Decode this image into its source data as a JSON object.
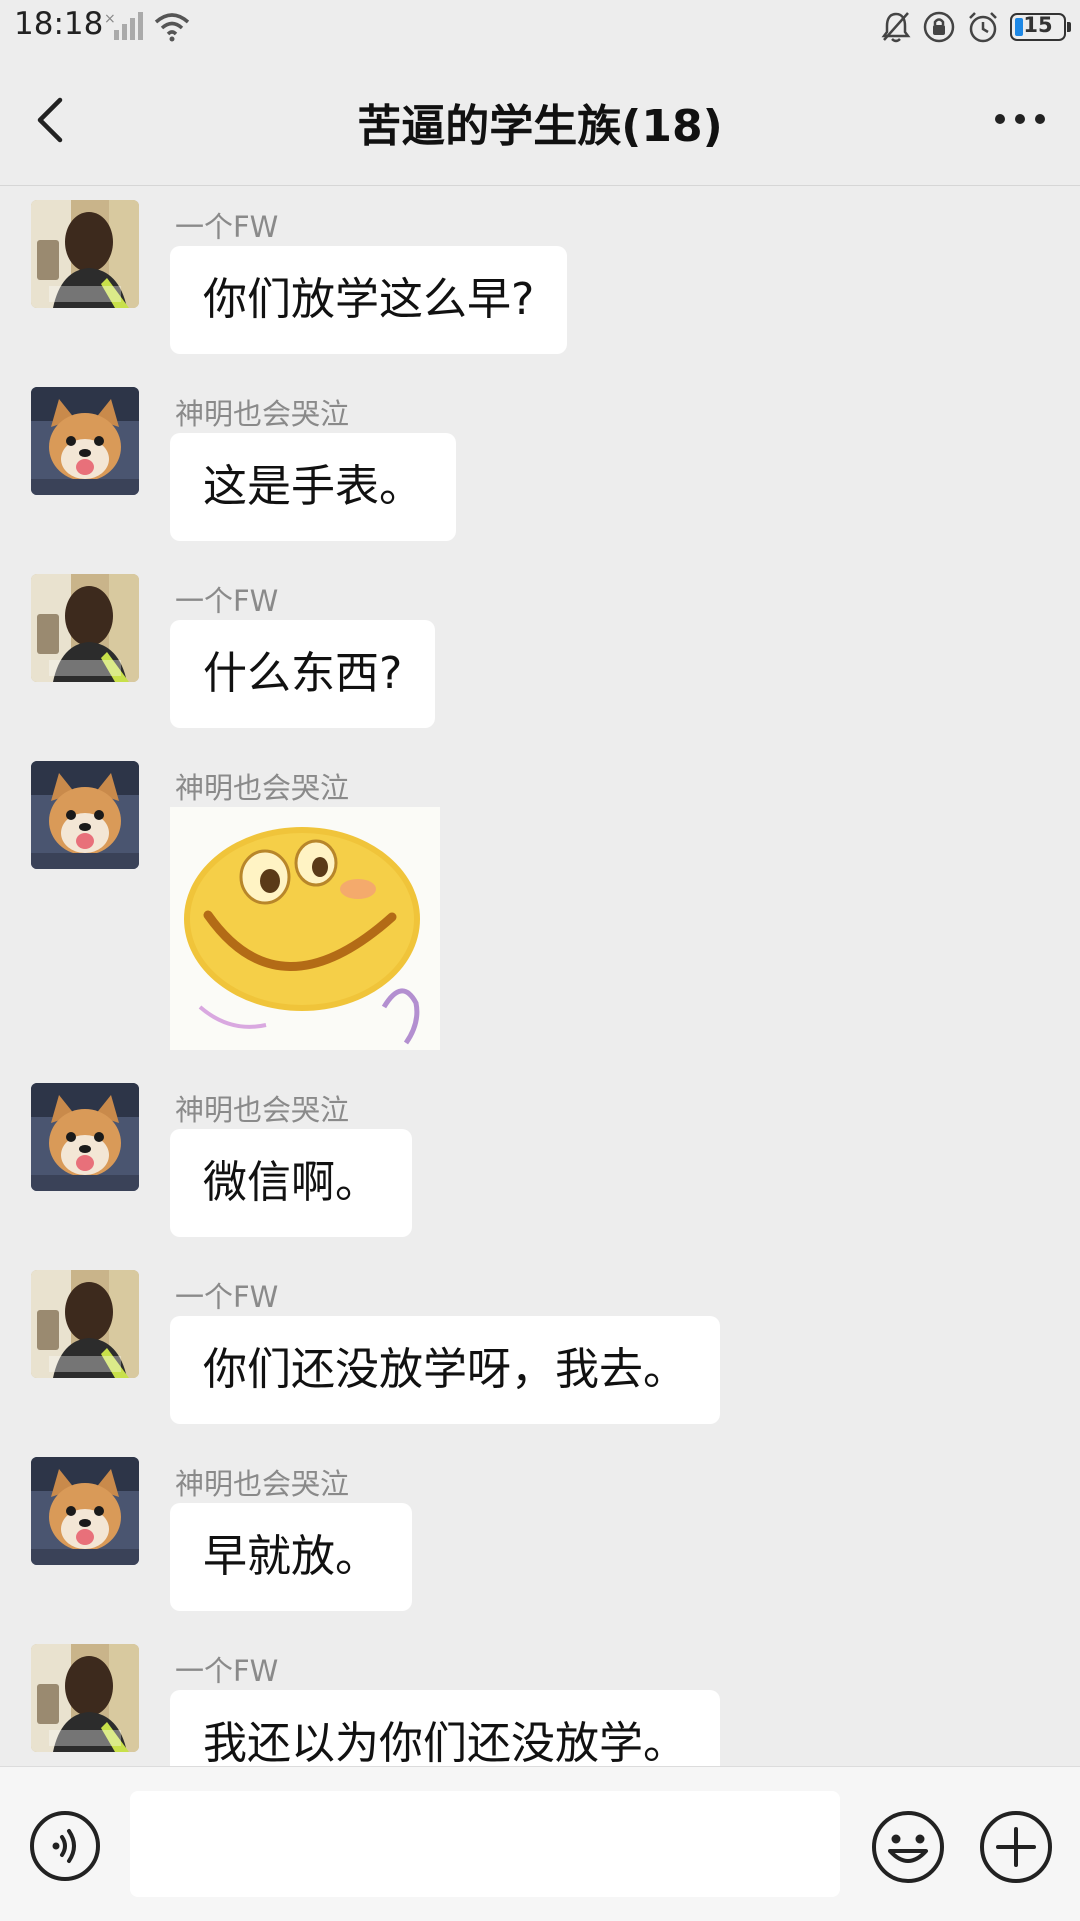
{
  "status": {
    "time": "18:18",
    "battery": "15"
  },
  "header": {
    "title": "苦逼的学生族(18)"
  },
  "messages": [
    {
      "sender": "一个FW",
      "text": "你们放学这么早?",
      "avatar": "man-photo"
    },
    {
      "sender": "神明也会哭泣",
      "text": "这是手表。",
      "avatar": "dog-photo"
    },
    {
      "sender": "一个FW",
      "text": "什么东西?",
      "avatar": "man-photo"
    },
    {
      "sender": "神明也会哭泣",
      "sticker": "smiley-face-sticker",
      "avatar": "dog-photo"
    },
    {
      "sender": "神明也会哭泣",
      "text": "微信啊。",
      "avatar": "dog-photo"
    },
    {
      "sender": "一个FW",
      "text": "你们还没放学呀，我去。",
      "avatar": "man-photo"
    },
    {
      "sender": "神明也会哭泣",
      "text": "早就放。",
      "avatar": "dog-photo"
    },
    {
      "sender": "一个FW",
      "text": "我还以为你们还没放学。",
      "avatar": "man-photo"
    }
  ],
  "input": {
    "placeholder": ""
  },
  "colors": {
    "background": "#ededed",
    "bubble": "#ffffff",
    "sender_name": "#8a8a8a",
    "battery_accent": "#1e88e5"
  }
}
